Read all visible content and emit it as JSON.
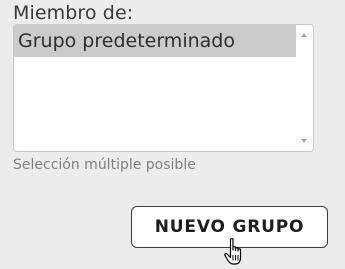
{
  "field": {
    "label": "Miembro de:",
    "options": [
      "Grupo predeterminado"
    ],
    "selected": "Grupo predeterminado",
    "help_text": "Selección múltiple posible"
  },
  "actions": {
    "new_group_label": "NUEVO GRUPO"
  },
  "colors": {
    "background": "#ececec",
    "selected_option": "#cbcbcb",
    "button_border": "#3b3b3b"
  },
  "icons": {
    "cursor": "hand-pointer-icon"
  }
}
